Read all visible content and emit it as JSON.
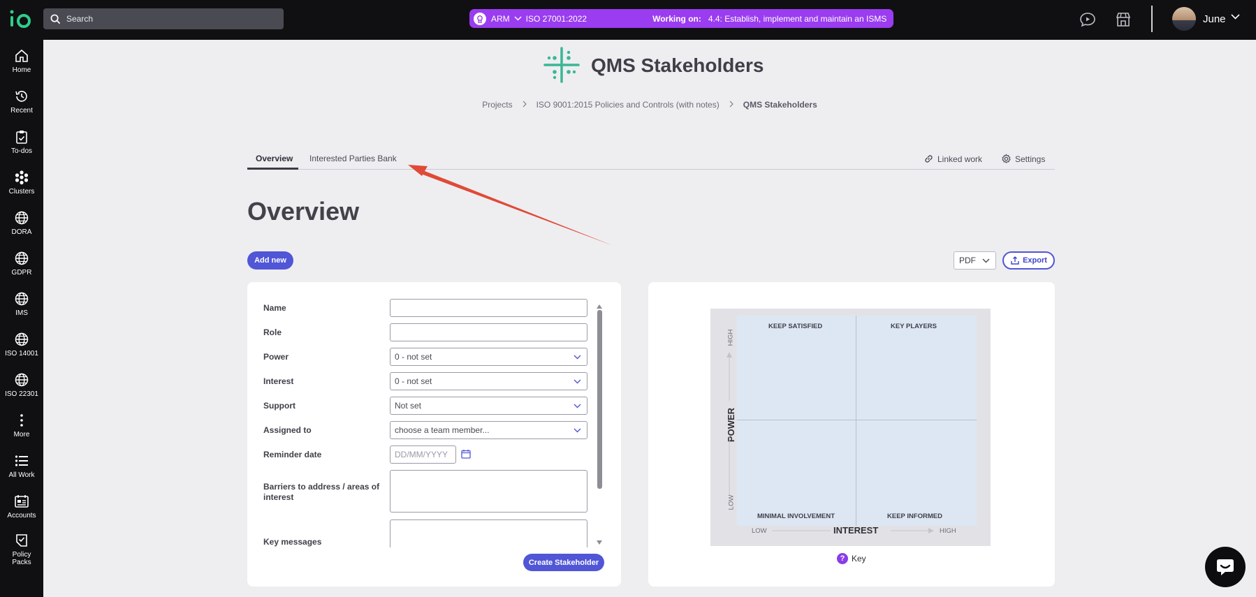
{
  "topbar": {
    "search_placeholder": "Search",
    "context_org": "ARM",
    "context_standard": "ISO 27001:2022",
    "working_on_label": "Working on:",
    "working_on_task": "4.4: Establish, implement and maintain an ISMS",
    "user_name": "June",
    "accent": "#9a3cf0"
  },
  "sidebar": {
    "items": [
      {
        "label": "Home",
        "icon": "home-icon"
      },
      {
        "label": "Recent",
        "icon": "history-icon"
      },
      {
        "label": "To-dos",
        "icon": "clipboard-check-icon"
      },
      {
        "label": "Clusters",
        "icon": "clusters-icon"
      },
      {
        "label": "DORA",
        "icon": "globe-icon"
      },
      {
        "label": "GDPR",
        "icon": "globe-icon"
      },
      {
        "label": "IMS",
        "icon": "globe-icon"
      },
      {
        "label": "ISO 14001",
        "icon": "globe-icon"
      },
      {
        "label": "ISO 22301",
        "icon": "globe-icon"
      },
      {
        "label": "More",
        "icon": "more-vertical-icon"
      },
      {
        "label": "All Work",
        "icon": "list-icon"
      },
      {
        "label": "Accounts",
        "icon": "accounts-icon"
      },
      {
        "label": "Policy Packs",
        "icon": "policy-check-icon"
      }
    ]
  },
  "header": {
    "title": "QMS Stakeholders",
    "breadcrumb": [
      "Projects",
      "ISO 9001:2015 Policies and Controls (with notes)",
      "QMS Stakeholders"
    ]
  },
  "tabs": {
    "overview": "Overview",
    "bank": "Interested Parties Bank",
    "linked_work": "Linked work",
    "settings": "Settings"
  },
  "main": {
    "heading": "Overview",
    "add_new": "Add new",
    "export_format": "PDF",
    "export": "Export"
  },
  "form": {
    "name_label": "Name",
    "name_value": "",
    "role_label": "Role",
    "role_value": "",
    "power_label": "Power",
    "power_value": "0 - not set",
    "interest_label": "Interest",
    "interest_value": "0 - not set",
    "support_label": "Support",
    "support_value": "Not set",
    "assigned_label": "Assigned to",
    "assigned_value": "choose a team member...",
    "reminder_label": "Reminder date",
    "reminder_placeholder": "DD/MM/YYYY",
    "barriers_label": "Barriers to address / areas of interest",
    "key_messages_label": "Key messages",
    "create_button": "Create Stakeholder"
  },
  "matrix": {
    "top_left": "KEEP SATISFIED",
    "top_right": "KEY PLAYERS",
    "bottom_left": "MINIMAL INVOLVEMENT",
    "bottom_right": "KEEP INFORMED",
    "y_axis": "POWER",
    "y_high": "HIGH",
    "y_low": "LOW",
    "x_axis": "INTEREST",
    "x_low": "LOW",
    "x_high": "HIGH",
    "key_label": "Key",
    "key_glyph": "?"
  }
}
